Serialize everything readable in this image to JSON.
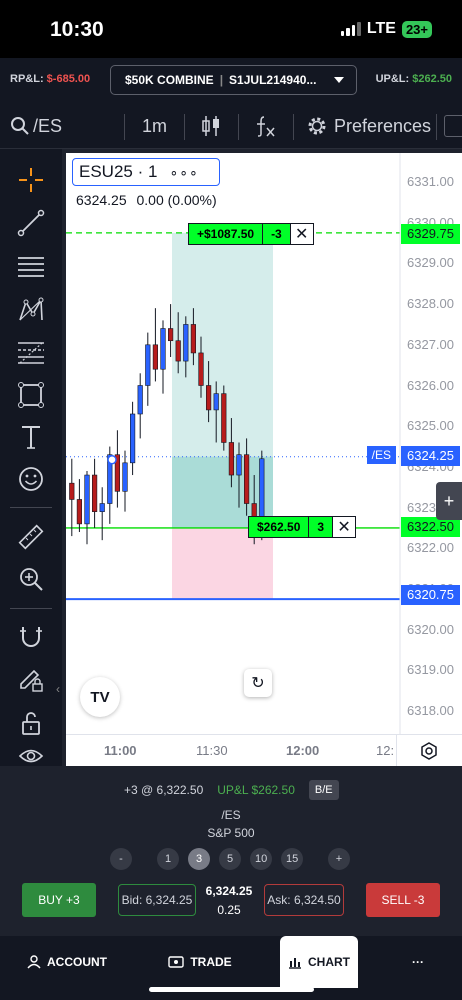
{
  "status_bar": {
    "time": "10:30",
    "network": "LTE",
    "battery": "23+"
  },
  "header": {
    "rpl_label": "RP&L:",
    "rpl_value": "$-685.00",
    "account_name": "$50K COMBINE",
    "account_id": "S1JUL214940...",
    "upl_label": "UP&L:",
    "upl_value": "$262.50"
  },
  "toolbar": {
    "symbol": "/ES",
    "interval": "1m",
    "preferences_label": "Preferences"
  },
  "chart": {
    "symbol_label": "ESU25 · 1",
    "more_label": "∘∘∘",
    "last_price": "6324.25",
    "change": "0.00 (0.00%)",
    "price_labels": [
      "6331.00",
      "6330.00",
      "6329.00",
      "6328.00",
      "6327.00",
      "6326.00",
      "6325.00",
      "6324.00",
      "6323.00",
      "6322.00",
      "6321.00",
      "6320.00",
      "6319.00",
      "6318.00"
    ],
    "time_labels": [
      "11:00",
      "11:30",
      "12:00",
      "12:"
    ],
    "target_price": "6329.75",
    "entry_price": "6322.50",
    "stop_price": "6320.75",
    "current_tag_symbol": "/ES",
    "current_tag_price": "6324.25",
    "target_order": {
      "pl": "+$1087.50",
      "qty": "-3",
      "close": "✕"
    },
    "entry_order": {
      "pl": "$262.50",
      "qty": "3",
      "close": "✕"
    },
    "plus_label": "+",
    "tv_logo": "TV",
    "reset_icon_glyph": "↻"
  },
  "position": {
    "summary": "+3 @ 6,322.50",
    "upl": "UP&L $262.50",
    "be_label": "B/E",
    "symbol": "/ES",
    "description": "S&P 500",
    "qty_buttons": [
      "-",
      "1",
      "3",
      "5",
      "10",
      "15",
      "+"
    ],
    "selected_qty": "3"
  },
  "order": {
    "buy_label": "BUY +3",
    "bid": "Bid: 6,324.25",
    "last": "6,324.25",
    "spread": "0.25",
    "ask": "Ask: 6,324.50",
    "sell_label": "SELL -3"
  },
  "nav": {
    "account": "ACCOUNT",
    "trade": "TRADE",
    "chart": "CHART",
    "more": "···"
  },
  "colors": {
    "negative": "#ef5350",
    "positive": "#4caf50",
    "order_green": "#00ff28",
    "target_line": "#00dd00",
    "stop_line": "#2962ff",
    "buy": "#2e8b3e",
    "sell": "#c93a3a"
  }
}
